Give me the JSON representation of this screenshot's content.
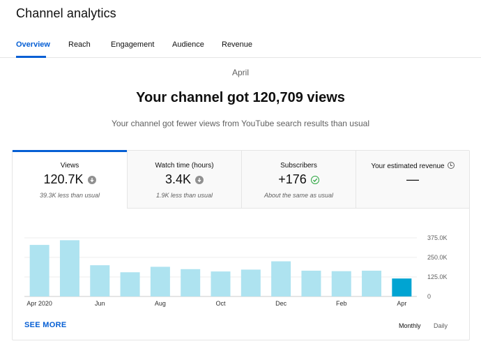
{
  "header": {
    "title": "Channel analytics"
  },
  "tabs": [
    {
      "label": "Overview",
      "active": true
    },
    {
      "label": "Reach"
    },
    {
      "label": "Engagement"
    },
    {
      "label": "Audience"
    },
    {
      "label": "Revenue"
    }
  ],
  "summary": {
    "period": "April",
    "headline": "Your channel got 120,709 views",
    "subline": "Your channel got fewer views from YouTube search results than usual"
  },
  "metrics": [
    {
      "label": "Views",
      "value": "120.7K",
      "note": "39.3K less than usual",
      "icon": "arrow-down-icon"
    },
    {
      "label": "Watch time (hours)",
      "value": "3.4K",
      "note": "1.9K less than usual",
      "icon": "arrow-down-icon"
    },
    {
      "label": "Subscribers",
      "value": "+176",
      "note": "About the same as usual",
      "icon": "check-circle-icon"
    },
    {
      "label": "Your estimated revenue",
      "value": "—",
      "icon": "clock-icon"
    }
  ],
  "colors": {
    "accent": "#065fd4",
    "bar": "#aee3f0",
    "bar_current": "#00a4d2",
    "check": "#2ba640"
  },
  "chart_data": {
    "type": "bar",
    "series": [
      {
        "values": [
          330000,
          360000,
          200000,
          155000,
          190000,
          175000,
          160000,
          172000,
          225000,
          165000,
          162000,
          165000,
          115000
        ]
      }
    ],
    "x_tick_labels": [
      "Apr 2020",
      "Jun",
      "Aug",
      "Oct",
      "Dec",
      "Feb",
      "Apr"
    ],
    "x_tick_indices": [
      0,
      2,
      4,
      6,
      8,
      10,
      12
    ],
    "y_tick_labels": [
      "375.0K",
      "250.0K",
      "125.0K",
      "0"
    ],
    "y_tick_values": [
      375000,
      250000,
      125000,
      0
    ],
    "ylim": [
      0,
      375000
    ],
    "highlight_last": true,
    "grid": true
  },
  "footer": {
    "see_more": "SEE MORE",
    "monthly": "Monthly",
    "daily": "Daily"
  }
}
